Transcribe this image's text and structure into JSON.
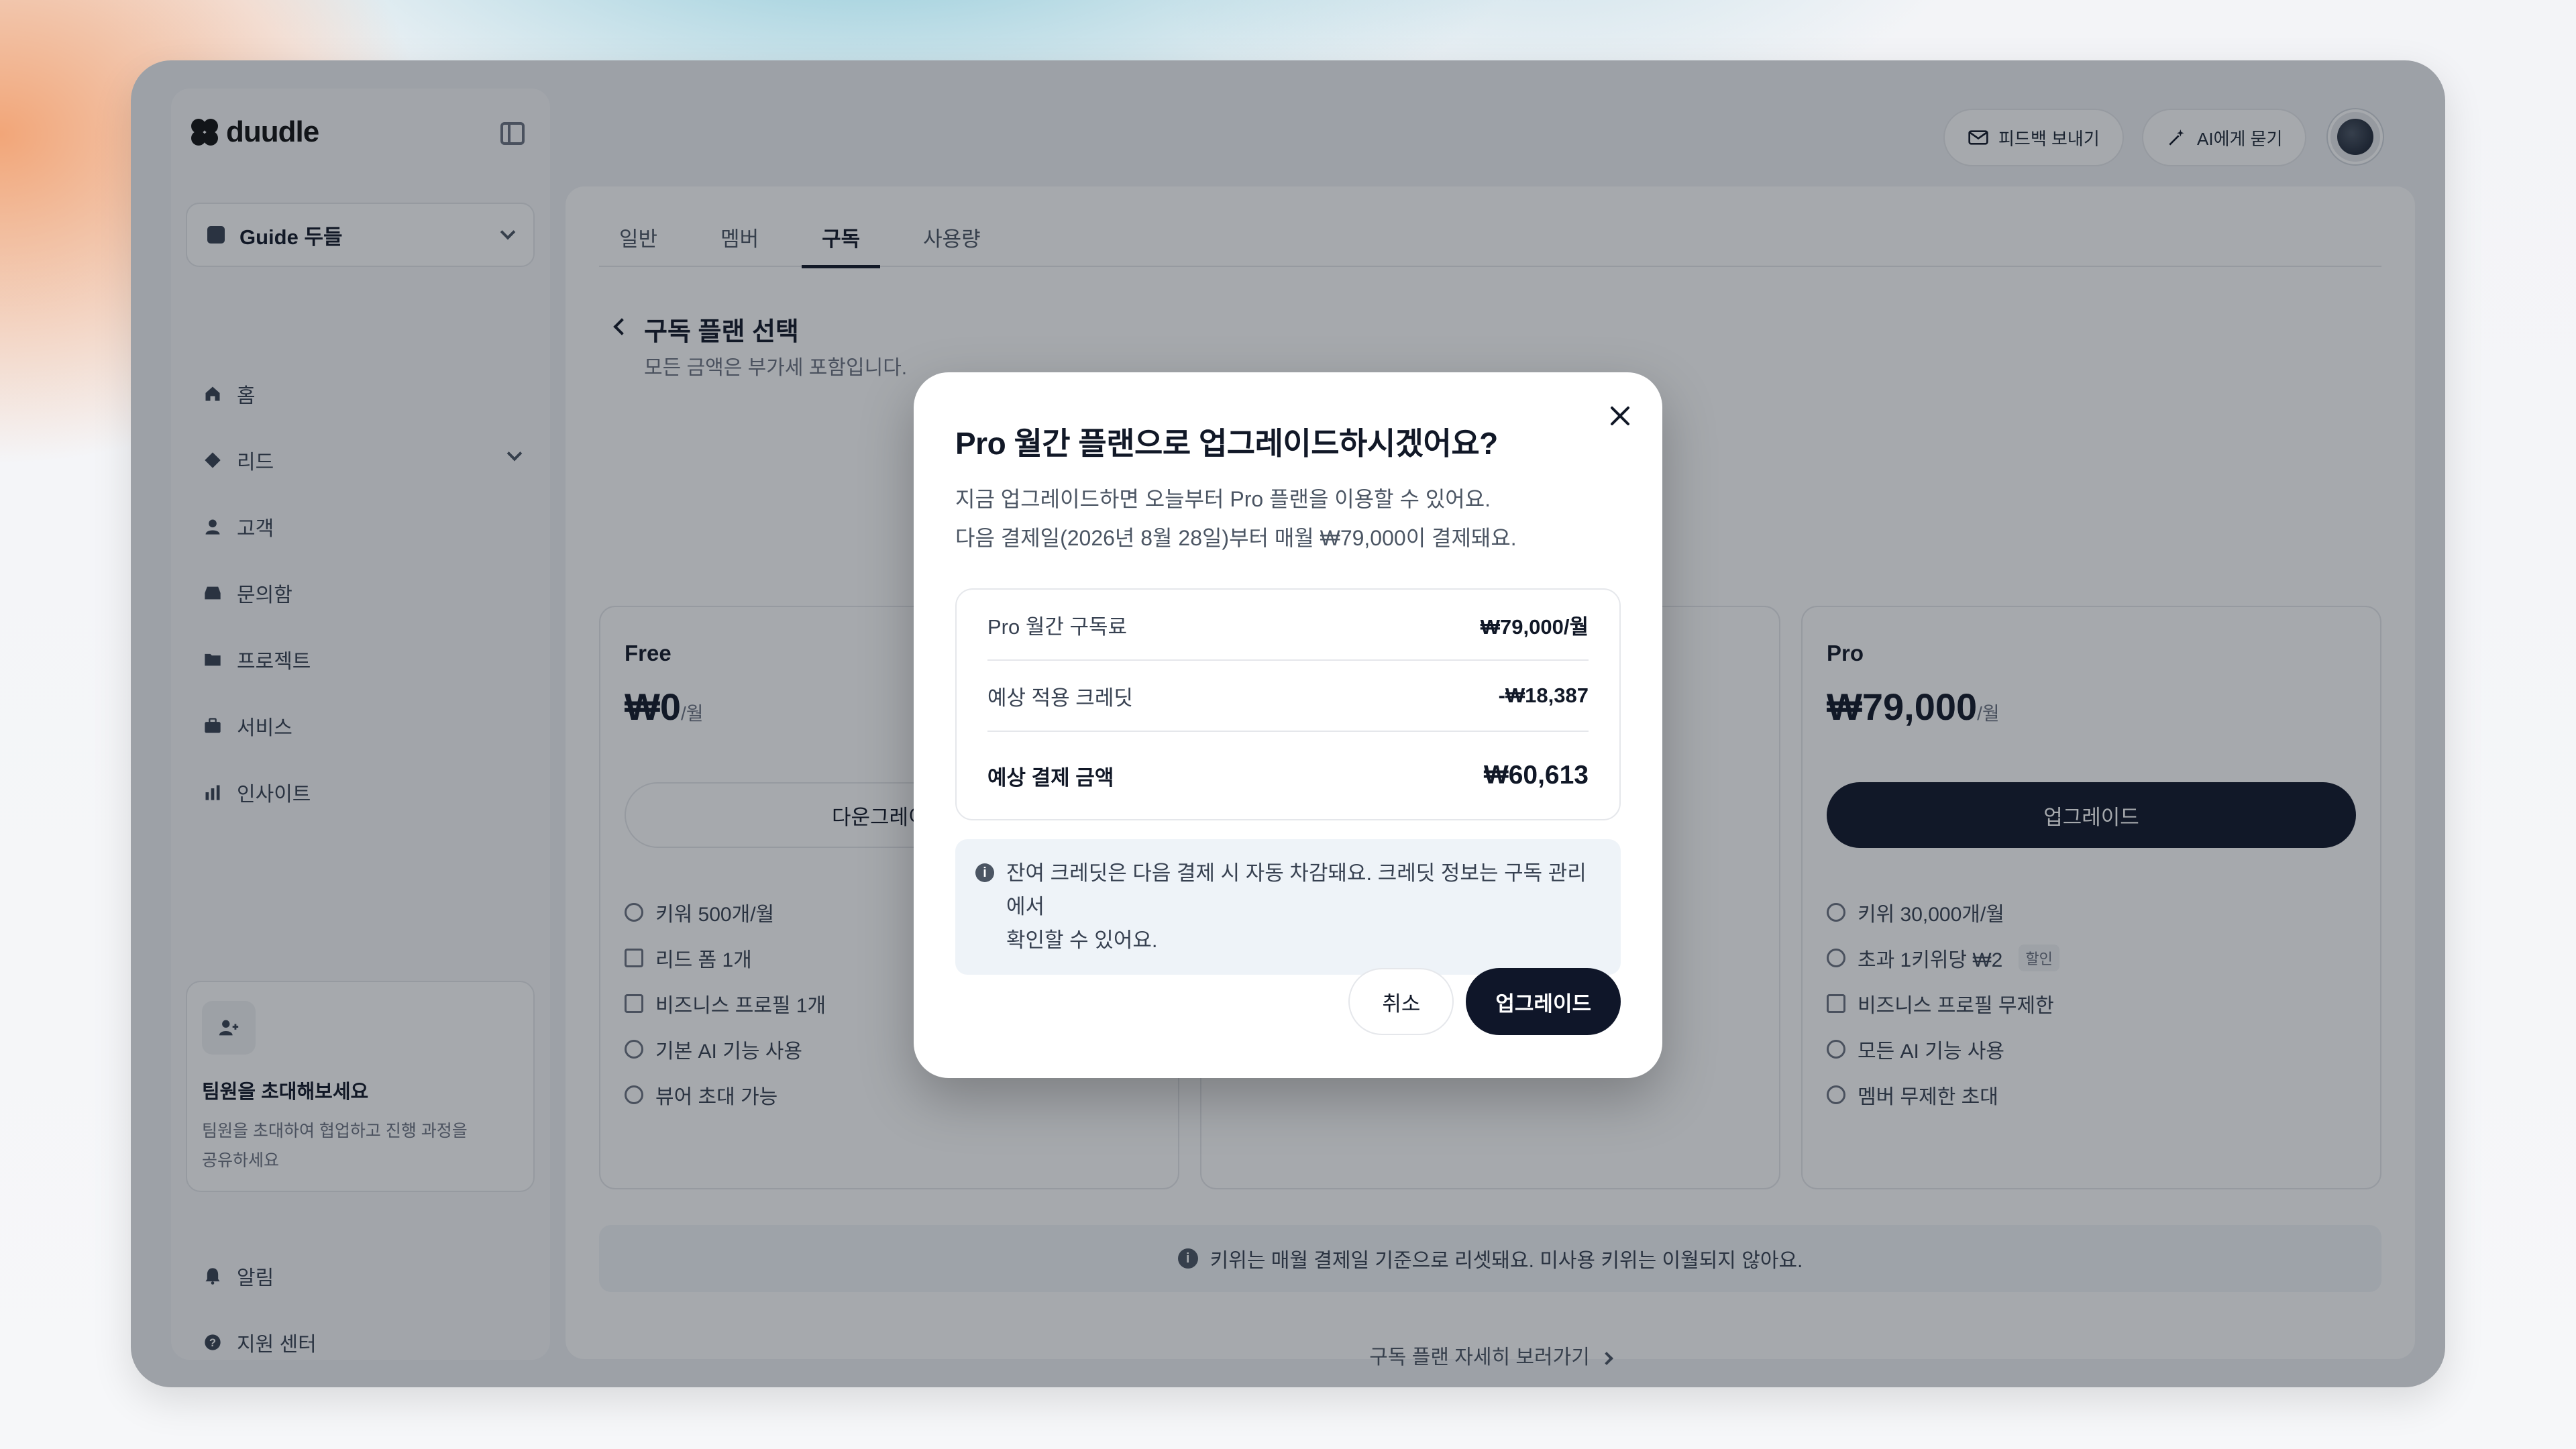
{
  "app": {
    "logo_text": "duudle",
    "workspace_name": "Guide 두들"
  },
  "sidebar": {
    "items": [
      {
        "label": "홈",
        "icon": "home-icon"
      },
      {
        "label": "리드",
        "icon": "lead-icon"
      },
      {
        "label": "고객",
        "icon": "user-icon"
      },
      {
        "label": "문의함",
        "icon": "inbox-icon"
      },
      {
        "label": "프로젝트",
        "icon": "folder-icon"
      },
      {
        "label": "서비스",
        "icon": "briefcase-icon"
      },
      {
        "label": "인사이트",
        "icon": "bar-chart-icon"
      }
    ],
    "invite": {
      "title": "팀원을 초대해보세요",
      "desc_line1": "팀원을 초대하여 협업하고 진행 과정을",
      "desc_line2": "공유하세요"
    },
    "bottom_items": [
      {
        "label": "알림",
        "icon": "bell-icon"
      },
      {
        "label": "지원 센터",
        "icon": "help-icon"
      }
    ]
  },
  "topbar": {
    "feedback_label": "피드백 보내기",
    "ask_ai_label": "AI에게 묻기"
  },
  "tabs": [
    {
      "label": "일반",
      "active": false
    },
    {
      "label": "멤버",
      "active": false
    },
    {
      "label": "구독",
      "active": true
    },
    {
      "label": "사용량",
      "active": false
    }
  ],
  "page": {
    "title": "구독 플랜 선택",
    "subtitle": "모든 금액은 부가세 포함입니다."
  },
  "plans": {
    "free": {
      "name": "Free",
      "price": "₩0",
      "unit": "/월",
      "button": "다운그레이드",
      "features": [
        "키워 500개/월",
        "리드 폼 1개",
        "비즈니스 프로필 1개",
        "기본 AI 기능 사용",
        "뷰어 초대 가능"
      ]
    },
    "pro": {
      "name": "Pro",
      "price": "₩79,000",
      "unit": "/월",
      "button": "업그레이드",
      "features": [
        "키위 30,000개/월",
        "초과 1키위당 ₩2",
        "비즈니스 프로필 무제한",
        "모든 AI 기능 사용",
        "멤버 무제한 초대"
      ],
      "discount_tag": "할인"
    }
  },
  "notice": "키위는 매월 결제일 기준으로 리셋돼요. 미사용 키위는 이월되지 않아요.",
  "more_link": "구독 플랜 자세히 보러가기",
  "modal": {
    "title": "Pro 월간 플랜으로 업그레이드하시겠어요?",
    "desc_line1": "지금 업그레이드하면 오늘부터 Pro 플랜을 이용할 수 있어요.",
    "desc_line2": "다음 결제일(2026년 8월 28일)부터 매월 ₩79,000이 결제돼요.",
    "rows": [
      {
        "label": "Pro 월간 구독료",
        "value": "₩79,000/월"
      },
      {
        "label": "예상 적용 크레딧",
        "value": "-₩18,387"
      },
      {
        "label": "예상 결제 금액",
        "value": "₩60,613"
      }
    ],
    "info_line1": "잔여 크레딧은 다음 결제 시 자동 차감돼요. 크레딧 정보는 구독 관리에서",
    "info_line2": "확인할 수 있어요.",
    "cancel_label": "취소",
    "confirm_label": "업그레이드"
  }
}
